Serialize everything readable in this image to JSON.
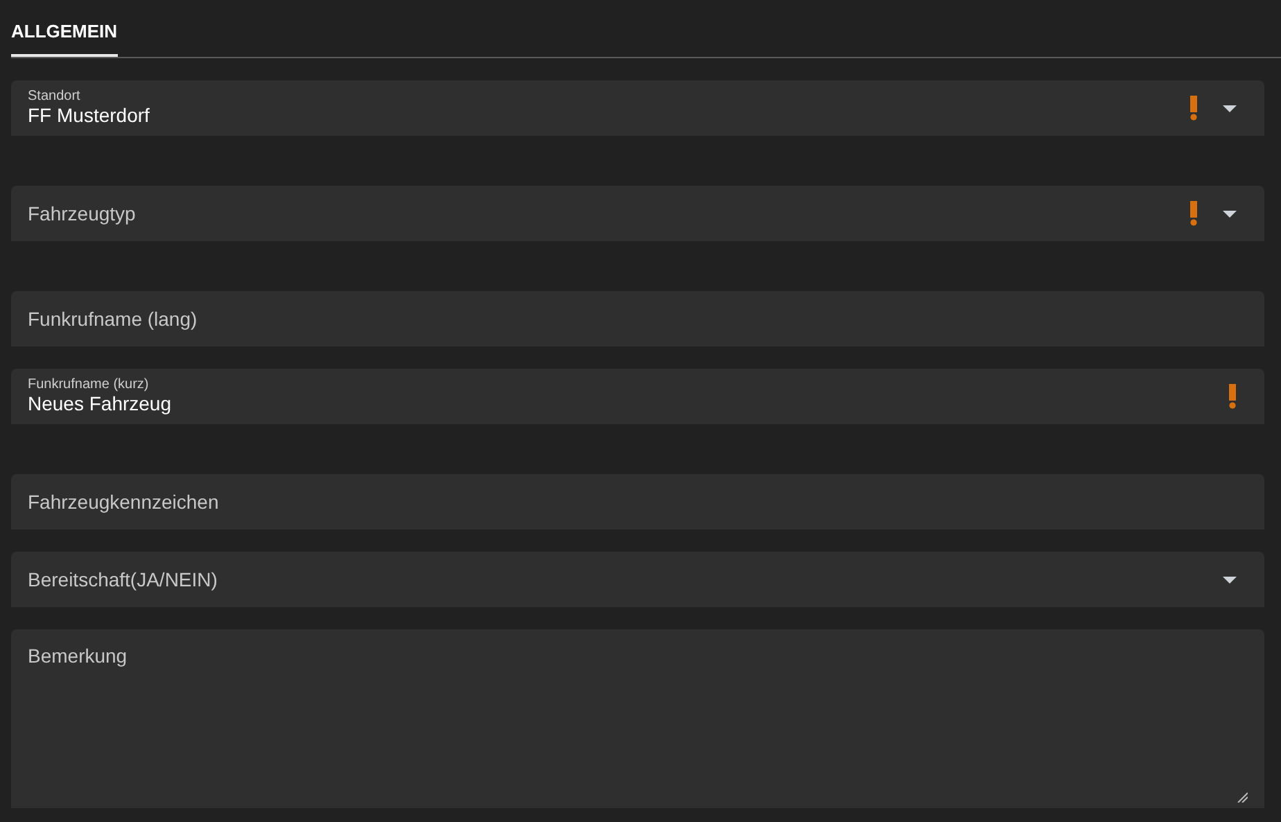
{
  "tabs": [
    {
      "label": "ALLGEMEIN",
      "selected": true
    }
  ],
  "fields": [
    {
      "kind": "select",
      "label": "Standort",
      "value": "FF Musterdorf",
      "warning": true
    },
    {
      "kind": "select",
      "label": "Fahrzeugtyp",
      "warning": true
    },
    {
      "kind": "text",
      "label": "Funkrufname (lang)",
      "warning": false
    },
    {
      "kind": "text",
      "label": "Funkrufname (kurz)",
      "value": "Neues Fahrzeug",
      "warning": true
    },
    {
      "kind": "text",
      "label": "Fahrzeugkennzeichen",
      "warning": false
    },
    {
      "kind": "select",
      "label": "Bereitschaft(JA/NEIN)",
      "warning": false
    },
    {
      "kind": "textarea",
      "label": "Bemerkung",
      "warning": false
    }
  ]
}
